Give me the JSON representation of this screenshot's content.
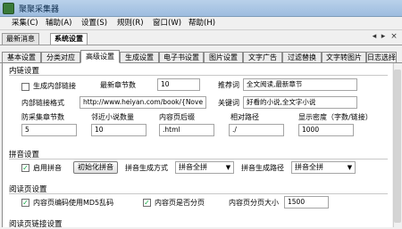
{
  "window": {
    "title": "聚聚采集器"
  },
  "menu": [
    "采集(C)",
    "辅助(A)",
    "设置(S)",
    "规则(R)",
    "窗口(W)",
    "帮助(H)"
  ],
  "doc_tabs": [
    "最新消息",
    "系统设置"
  ],
  "doc_controls": {
    "prev": "◂",
    "next": "▸",
    "close": "×"
  },
  "settings_tabs": [
    "基本设置",
    "分类对应",
    "高级设置",
    "生成设置",
    "电子书设置",
    "图片设置",
    "文字广告",
    "过滤替换",
    "文字转图片",
    "日志选择"
  ],
  "inner_links": {
    "title": "内链设置",
    "gen_inner_links_label": "生成内部链接",
    "latest_chapters_label": "最新章节数",
    "latest_chapters_value": "10",
    "recommend_label": "推荐词",
    "recommend_value": "全文阅读,最新章节",
    "link_format_label": "内部链接格式",
    "link_format_value": "http://www.heiyan.com/book/{Nove",
    "keywords_label": "关键词",
    "keywords_value": "好看的小说,全文字小说",
    "anti_collect_label": "防采集章节数",
    "anti_collect_value": "5",
    "neighbor_count_label": "邻近小说数量",
    "neighbor_count_value": "10",
    "page_suffix_label": "内容页后缀",
    "page_suffix_value": ".html",
    "relative_path_label": "相对路径",
    "relative_path_value": "./",
    "display_density_label": "显示密度（字数/链接）",
    "display_density_value": "1000"
  },
  "pinyin": {
    "title": "拼音设置",
    "enable_label": "启用拼音",
    "init_button": "初始化拼音",
    "gen_mode_label": "拼音生成方式",
    "gen_mode_value": "拼音全拼",
    "gen_path_label": "拼音生成路径",
    "gen_path_value": "拼音全拼"
  },
  "reading": {
    "title": "阅读页设置",
    "md5_label": "内容页编码使用MD5乱码",
    "paging_label": "内容页是否分页",
    "page_size_label": "内容页分页大小",
    "page_size_value": "1500"
  },
  "reading_link": {
    "title": "阅读页链接设置"
  }
}
